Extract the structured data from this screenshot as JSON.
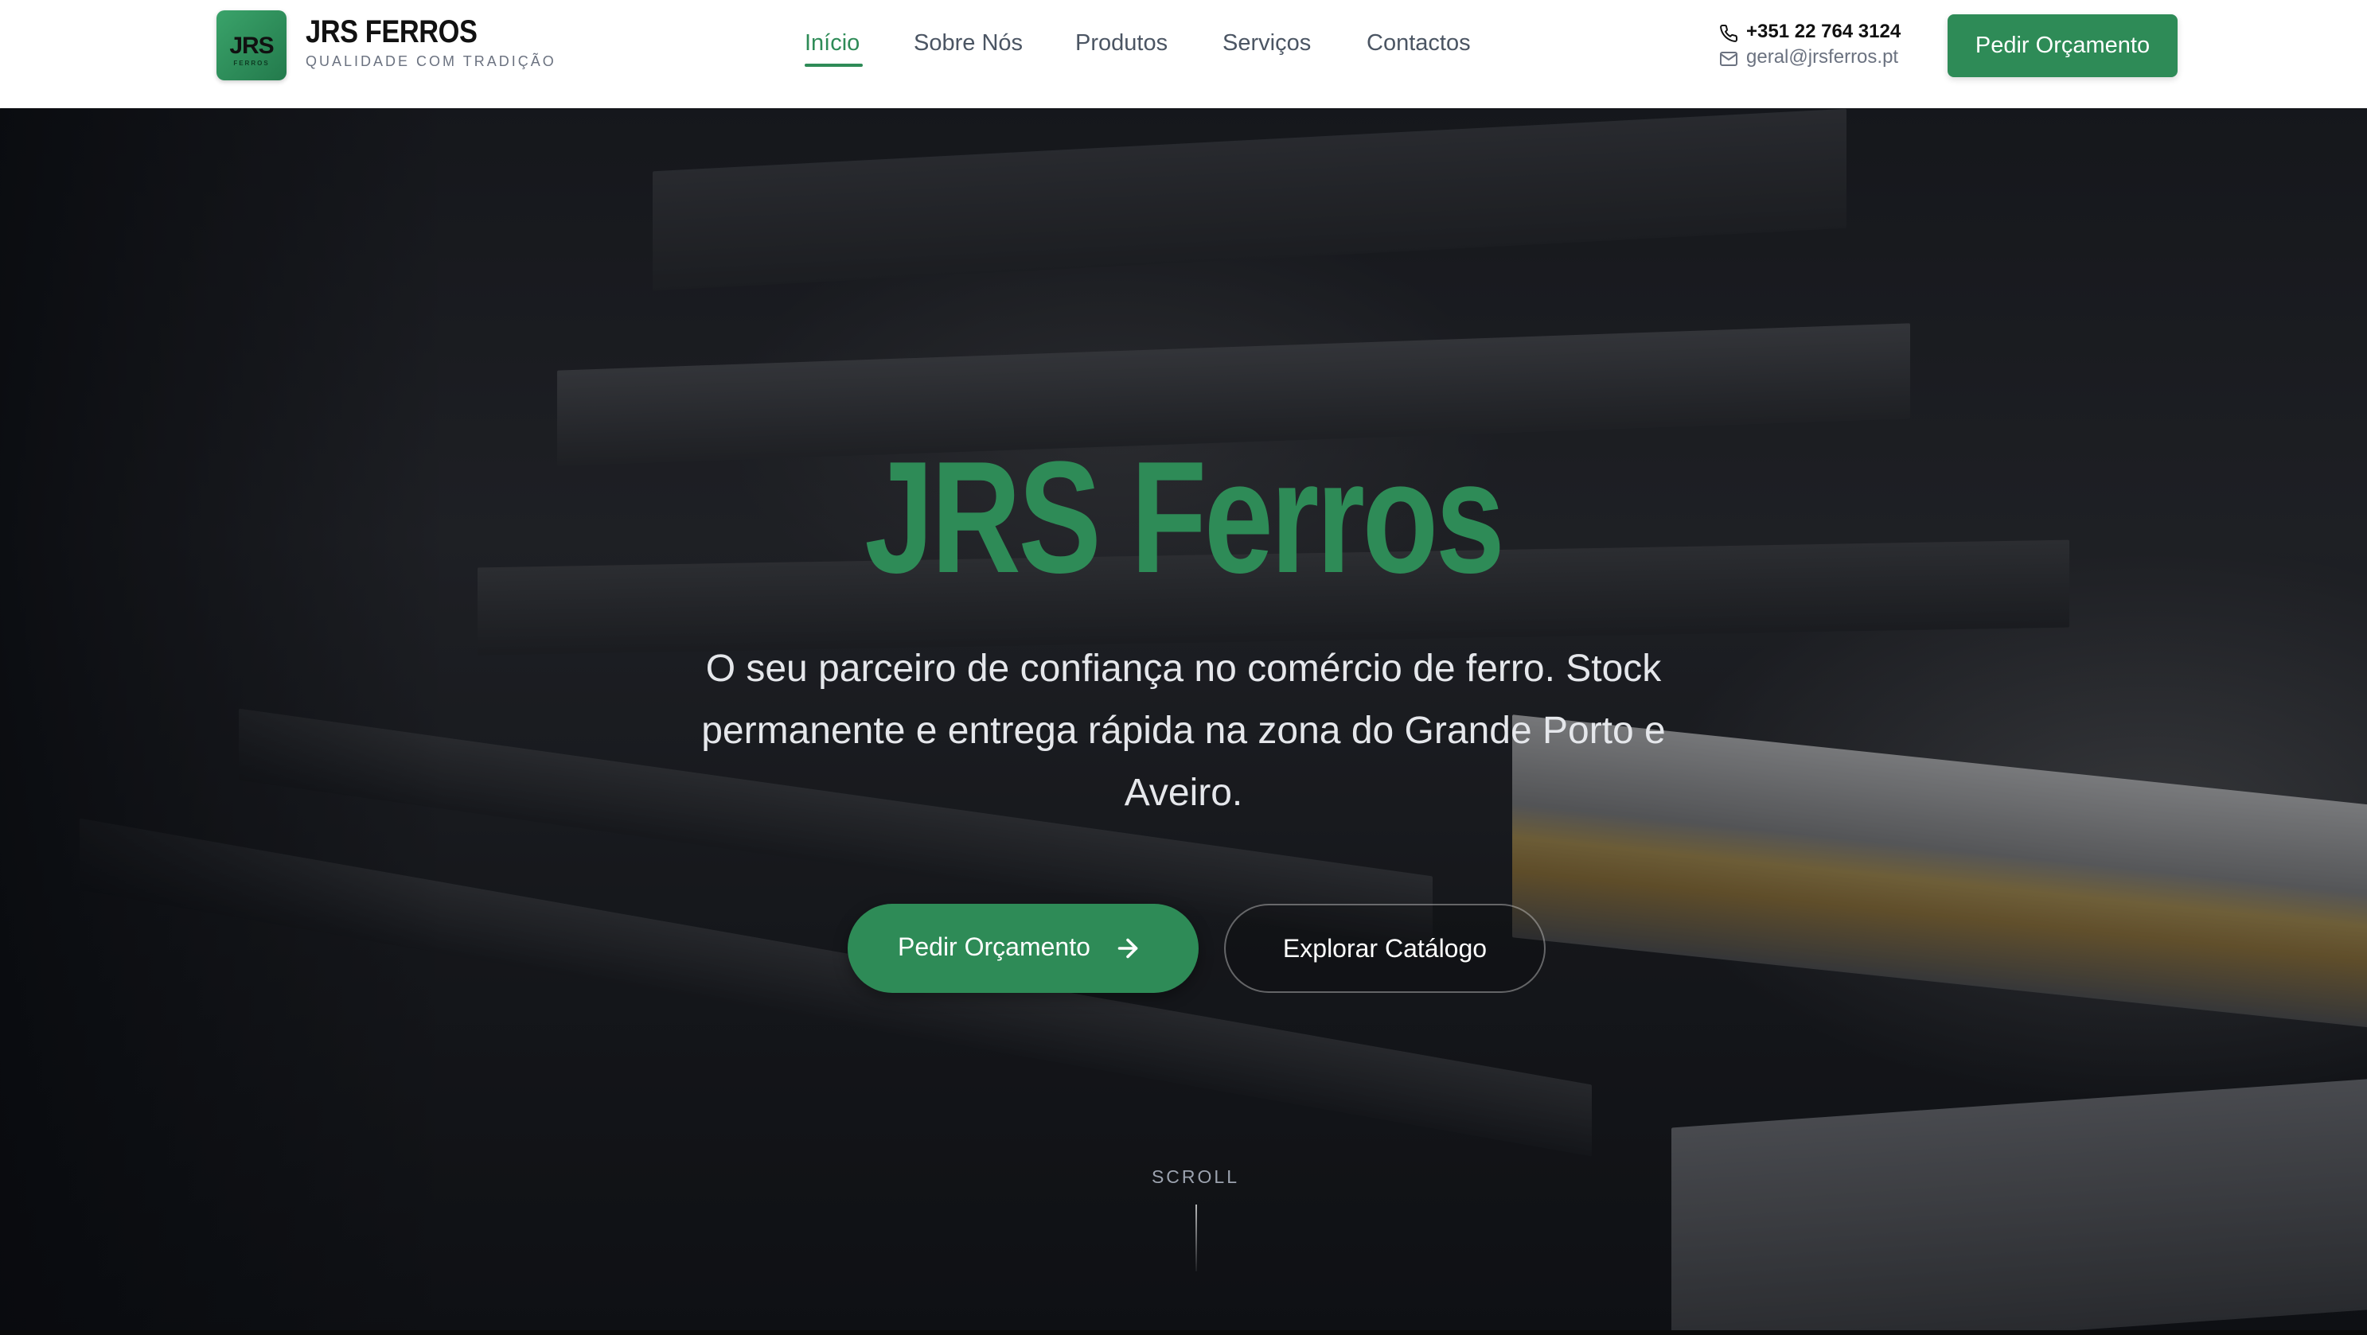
{
  "brand": {
    "logo_mark": "JRS",
    "logo_sub": "FERROS",
    "name": "JRS FERROS",
    "tagline": "QUALIDADE COM TRADIÇÃO"
  },
  "nav": {
    "items": [
      {
        "label": "Início",
        "active": true
      },
      {
        "label": "Sobre Nós",
        "active": false
      },
      {
        "label": "Produtos",
        "active": false
      },
      {
        "label": "Serviços",
        "active": false
      },
      {
        "label": "Contactos",
        "active": false
      }
    ]
  },
  "contact": {
    "phone": "+351 22 764 3124",
    "email": "geral@jrsferros.pt"
  },
  "header": {
    "cta_label": "Pedir Orçamento"
  },
  "hero": {
    "title": "JRS Ferros",
    "description": "O seu parceiro de confiança no comércio de ferro. Stock permanente e entrega rápida na zona do Grande Porto e Aveiro.",
    "primary_cta": "Pedir Orçamento",
    "secondary_cta": "Explorar Catálogo",
    "scroll_label": "SCROLL"
  },
  "colors": {
    "accent": "#2e8b57",
    "header_bg": "#ffffff",
    "hero_text": "#e5e7eb"
  },
  "icons": {
    "phone": "phone-icon",
    "email": "mail-icon",
    "arrow": "arrow-right-icon"
  }
}
